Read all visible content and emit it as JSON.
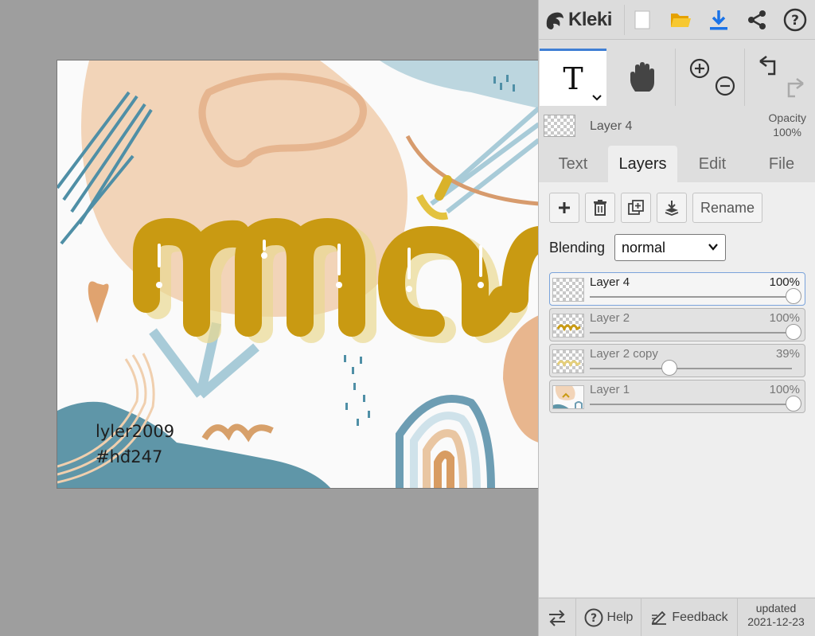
{
  "app": {
    "name": "Kleki"
  },
  "toolbar": {
    "new_icon": "new-image-icon",
    "open_icon": "open-folder-icon",
    "save_icon": "download-icon",
    "share_icon": "share-icon",
    "help_icon": "help-icon"
  },
  "tools": {
    "text_glyph": "T",
    "hand_icon": "hand-icon",
    "zoom_in_icon": "zoom-in-icon",
    "zoom_out_icon": "zoom-out-icon",
    "undo_icon": "undo-icon",
    "redo_icon": "redo-icon"
  },
  "current_layer": {
    "name": "Layer 4",
    "opacity_label": "Opacity",
    "opacity_value": "100%"
  },
  "tabs": [
    {
      "label": "Text"
    },
    {
      "label": "Layers"
    },
    {
      "label": "Edit"
    },
    {
      "label": "File"
    }
  ],
  "layer_actions": {
    "rename_label": "Rename"
  },
  "blending": {
    "label": "Blending",
    "value": "normal"
  },
  "layers": [
    {
      "name": "Layer 4",
      "opacity": "100%",
      "opacity_fraction": 1.0
    },
    {
      "name": "Layer 2",
      "opacity": "100%",
      "opacity_fraction": 1.0
    },
    {
      "name": "Layer 2 copy",
      "opacity": "39%",
      "opacity_fraction": 0.39
    },
    {
      "name": "Layer 1",
      "opacity": "100%",
      "opacity_fraction": 1.0
    }
  ],
  "canvas": {
    "text_line1": "lyler2009",
    "text_line2": "#hđ247"
  },
  "footer": {
    "help_label": "Help",
    "feedback_label": "Feedback",
    "updated_label": "updated",
    "updated_date": "2021-12-23"
  },
  "colors": {
    "accent": "#3f7fd4",
    "download": "#1a73e8",
    "folder": "#f4b400",
    "lettering": "#c99a12"
  }
}
